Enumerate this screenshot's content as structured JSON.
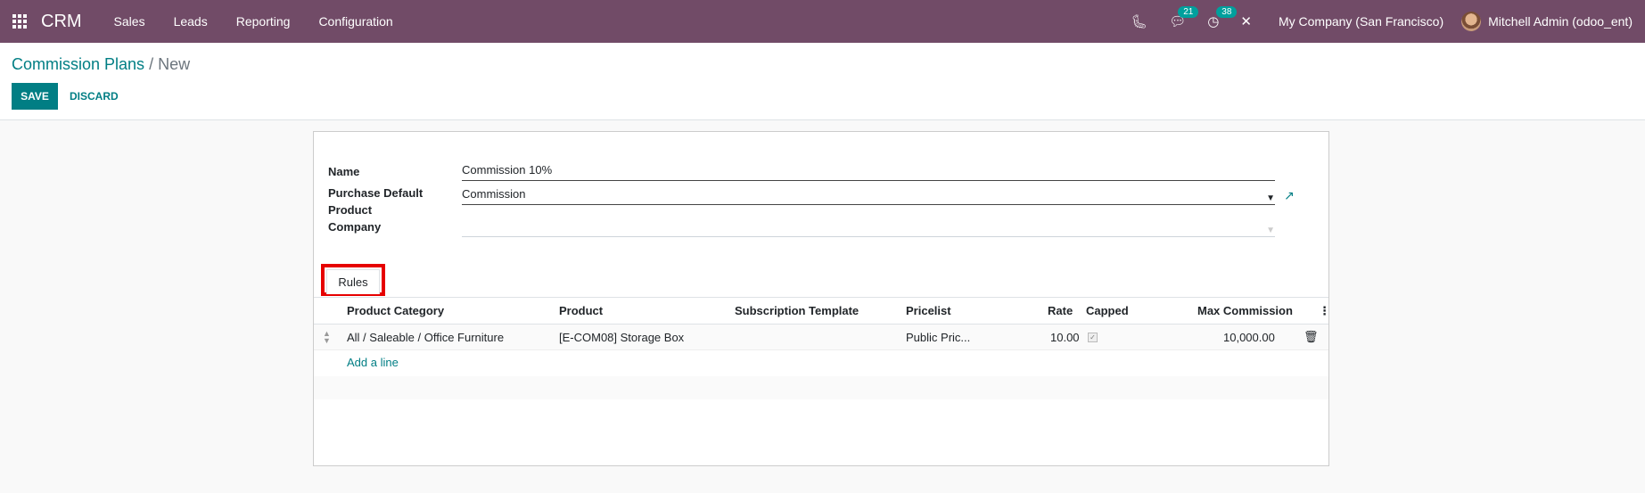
{
  "navbar": {
    "brand": "CRM",
    "menu": [
      "Sales",
      "Leads",
      "Reporting",
      "Configuration"
    ],
    "messages_count": "21",
    "activities_count": "38",
    "company": "My Company (San Francisco)",
    "user": "Mitchell Admin (odoo_ent)"
  },
  "control_panel": {
    "breadcrumb_parent": "Commission Plans",
    "breadcrumb_sep": "/",
    "breadcrumb_current": "New",
    "save_label": "SAVE",
    "discard_label": "DISCARD"
  },
  "form": {
    "name_label": "Name",
    "name_value": "Commission 10%",
    "product_label_1": "Purchase Default",
    "product_label_2": "Product",
    "product_value": "Commission",
    "company_label": "Company",
    "company_value": ""
  },
  "tabs": {
    "rules": "Rules"
  },
  "table": {
    "headers": [
      "Product Category",
      "Product",
      "Subscription Template",
      "Pricelist",
      "Rate",
      "Capped",
      "Max Commission"
    ],
    "rows": [
      {
        "category": "All / Saleable / Office Furniture",
        "product": "[E-COM08] Storage Box",
        "subscription_template": "",
        "pricelist": "Public Pric...",
        "rate": "10.00",
        "capped": true,
        "max_commission": "10,000.00"
      }
    ],
    "add_line": "Add a line"
  },
  "colors": {
    "navbar": "#714b67",
    "primary": "#017e84",
    "highlight": "#e60000"
  }
}
